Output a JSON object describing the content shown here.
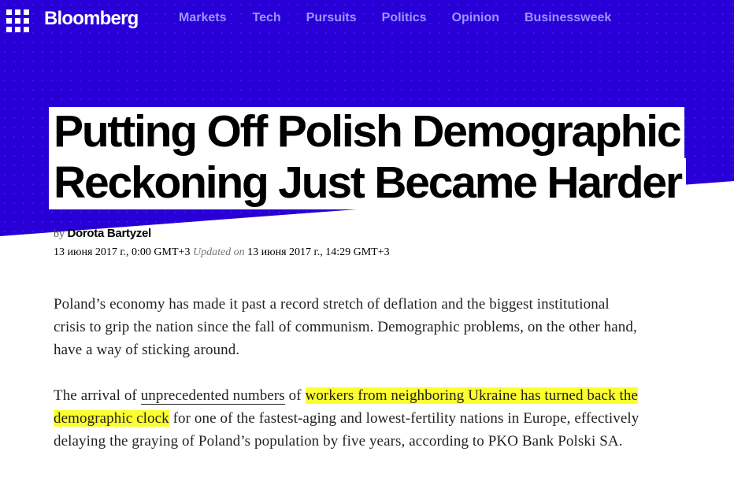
{
  "colors": {
    "hero_bg": "#2800d7",
    "nav_link": "#9b95ff",
    "highlight": "#fcff2f"
  },
  "nav": {
    "menu_icon": "grid-menu-icon",
    "logo": "Bloomberg",
    "links": [
      "Markets",
      "Tech",
      "Pursuits",
      "Politics",
      "Opinion",
      "Businessweek"
    ]
  },
  "headline": {
    "line1": "Putting Off Polish Demographic",
    "line2": "Reckoning Just Became Harder"
  },
  "byline": {
    "prefix": "by",
    "author": "Dorota Bartyzel"
  },
  "dates": {
    "published": "13 июня 2017 г., 0:00 GMT+3",
    "updated_label": "Updated on",
    "updated": "13 июня 2017 г., 14:29 GMT+3"
  },
  "article": {
    "p1": "Poland’s economy has made it past a record stretch of deflation and the biggest institutional crisis to grip the nation since the fall of communism. Demographic problems, on the other hand, have a way of sticking around.",
    "p2": {
      "t1": "The arrival of ",
      "link": "unprecedented numbers",
      "t2": " of ",
      "highlight": "workers from neighboring Ukraine has turned back the demographic clock",
      "t3": " for one of the fastest-aging and lowest-fertility nations in Europe, effectively delaying the graying of Poland’s population by five years, according to PKO Bank Polski SA."
    }
  }
}
